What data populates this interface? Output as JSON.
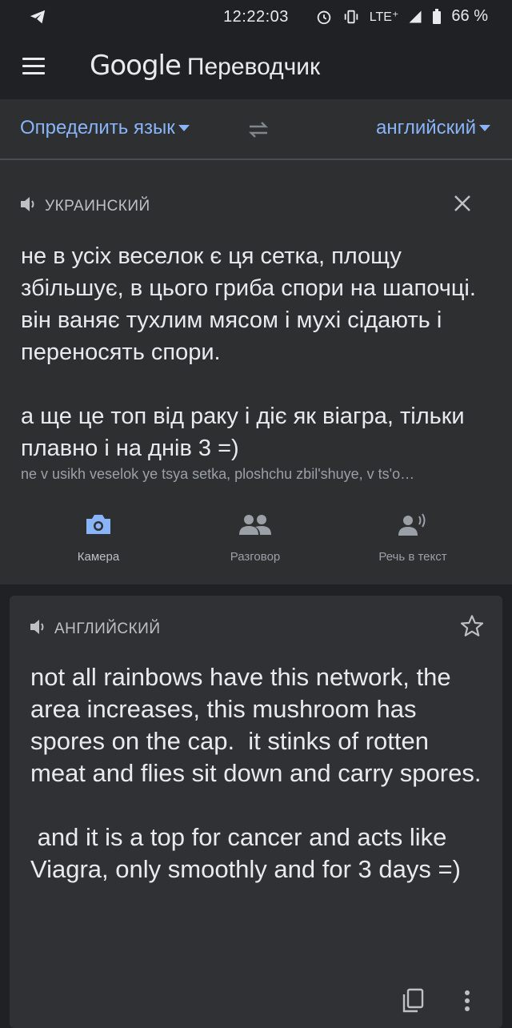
{
  "status_bar": {
    "time": "12:22:03",
    "network": "LTE⁺",
    "battery": "66 %"
  },
  "app_bar": {
    "brand": "Google",
    "product": "Переводчик"
  },
  "language_bar": {
    "source_language": "Определить язык",
    "target_language": "английский"
  },
  "input": {
    "detected_language": "УКРАИНСКИЙ",
    "text": "не в усіх веселок є ця сетка, площу збільшує, в цього гриба спори на шапочці. він ваняє тухлим мясом і мухі сідають і переносять спори.\n\nа ще це топ від раку і діє як віагра, тільки плавно і на днів 3 =)",
    "transliteration": "ne v usikh veselok ye tsya setka, ploshchu zbilʹshuye, v tsʹo…"
  },
  "tools": {
    "camera": "Камера",
    "conversation": "Разговор",
    "speech": "Речь в текст"
  },
  "result": {
    "language": "АНГЛИЙСКИЙ",
    "text": "not all rainbows have this network, the area increases, this mushroom has spores on the cap.  it stinks of rotten meat and flies sit down and carry spores.\n\n and it is a top for cancer and acts like Viagra, only smoothly and for 3 days =)"
  },
  "colors": {
    "accent": "#8ab4f8",
    "background": "#202124",
    "card": "#2d2f31"
  }
}
